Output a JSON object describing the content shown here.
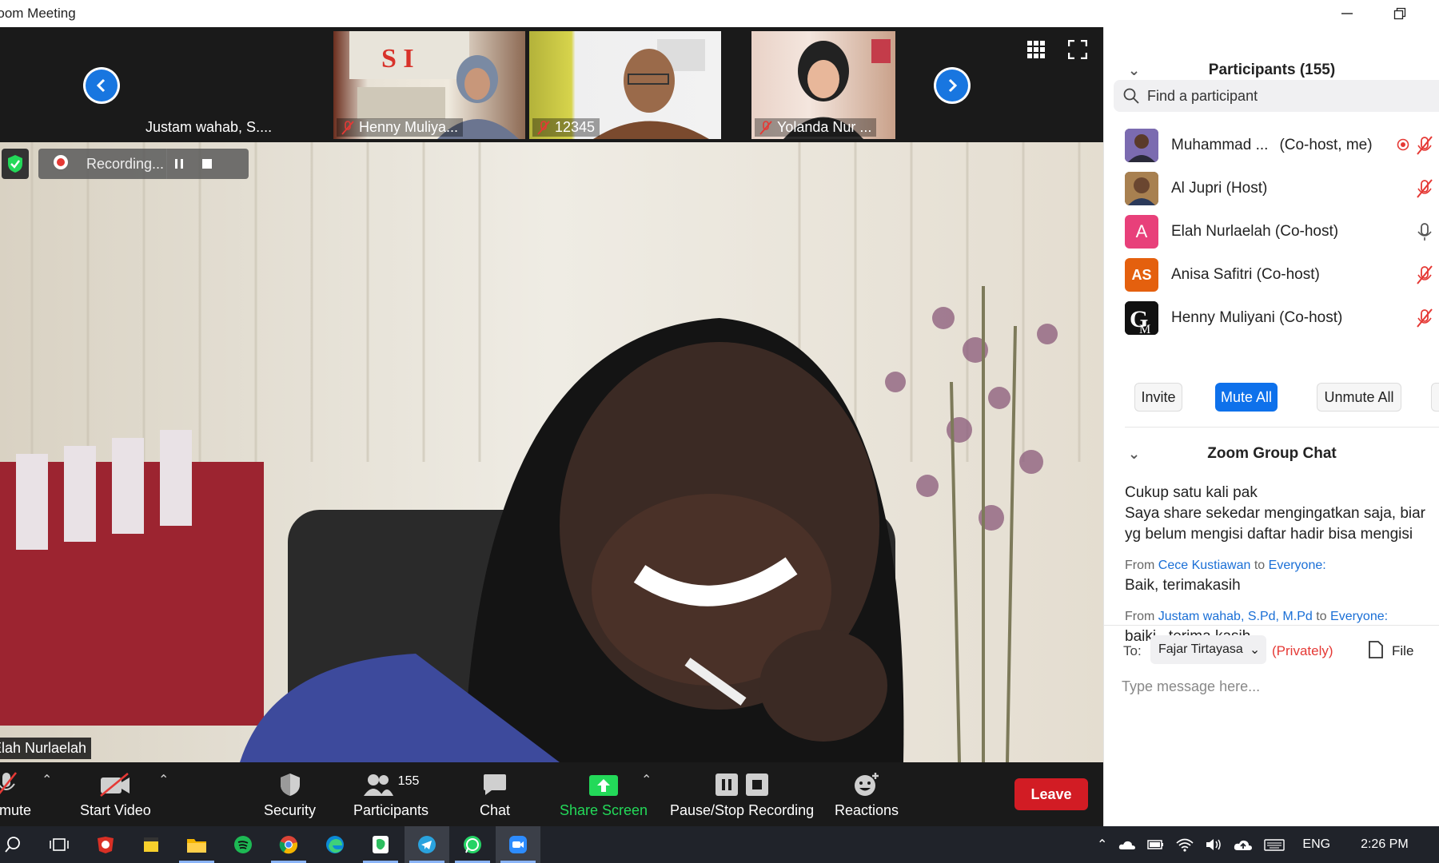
{
  "window": {
    "title": "Zoom Meeting",
    "minimize_icon": "minimize-icon",
    "restore_icon": "restore-icon"
  },
  "gallery": {
    "thumbs": [
      {
        "name": "Justam wahab, S...."
      },
      {
        "name": "Henny Muliya..."
      },
      {
        "name": "12345"
      },
      {
        "name": "Yolanda Nur ..."
      }
    ],
    "prev_icon": "chevron-left-icon",
    "next_icon": "chevron-right-icon"
  },
  "main_video": {
    "speaker_name": "Elah Nurlaelah",
    "recording_label": "Recording..."
  },
  "toolbar": {
    "mute_label": "Unmute",
    "video_label": "Start Video",
    "security_label": "Security",
    "participants_label": "Participants",
    "participants_count": "155",
    "chat_label": "Chat",
    "share_label": "Share Screen",
    "record_label": "Pause/Stop Recording",
    "reactions_label": "Reactions",
    "leave_label": "Leave",
    "share_color": "#23d959",
    "leave_color": "#d21c24"
  },
  "participants_panel": {
    "title": "Participants (155)",
    "search_placeholder": "Find a participant",
    "list": [
      {
        "name": "Muhammad ...",
        "role": "(Co-host, me)",
        "mic": "muted"
      },
      {
        "name": "Al Jupri (Host)",
        "role": "",
        "mic": "muted"
      },
      {
        "name": "Elah Nurlaelah (Co-host)",
        "role": "",
        "mic": "on",
        "avatar": "A",
        "avatar_color": "#e8407a"
      },
      {
        "name": "Anisa Safitri (Co-host)",
        "role": "",
        "mic": "muted",
        "avatar": "AS",
        "avatar_color": "#e4600e"
      },
      {
        "name": "Henny Muliyani (Co-host)",
        "role": "",
        "mic": "muted"
      }
    ],
    "buttons": {
      "invite": "Invite",
      "mute_all": "Mute All",
      "unmute_all": "Unmute All"
    }
  },
  "chat_panel": {
    "title": "Zoom Group Chat",
    "messages": [
      {
        "text": "Cukup satu kali pak"
      },
      {
        "text": "Saya share sekedar mengingatkan saja, biar yg belum mengisi daftar hadir bisa mengisi"
      }
    ],
    "msg3": {
      "from_word": "From",
      "sender": "Cece Kustiawan",
      "to_word": "to",
      "recipient": "Everyone:",
      "text": "Baik, terimakasih"
    },
    "msg4": {
      "from_word": "From",
      "sender": "Justam wahab, S.Pd, M.Pd",
      "to_word": "to",
      "recipient": "Everyone:",
      "text": "baiki , terima kasih,"
    },
    "to_label": "To:",
    "to_value": "Fajar Tirtayasa",
    "privately": "(Privately)",
    "file_label": "File",
    "input_placeholder": "Type message here..."
  },
  "taskbar": {
    "lang": "ENG",
    "time": "2:26 PM"
  }
}
